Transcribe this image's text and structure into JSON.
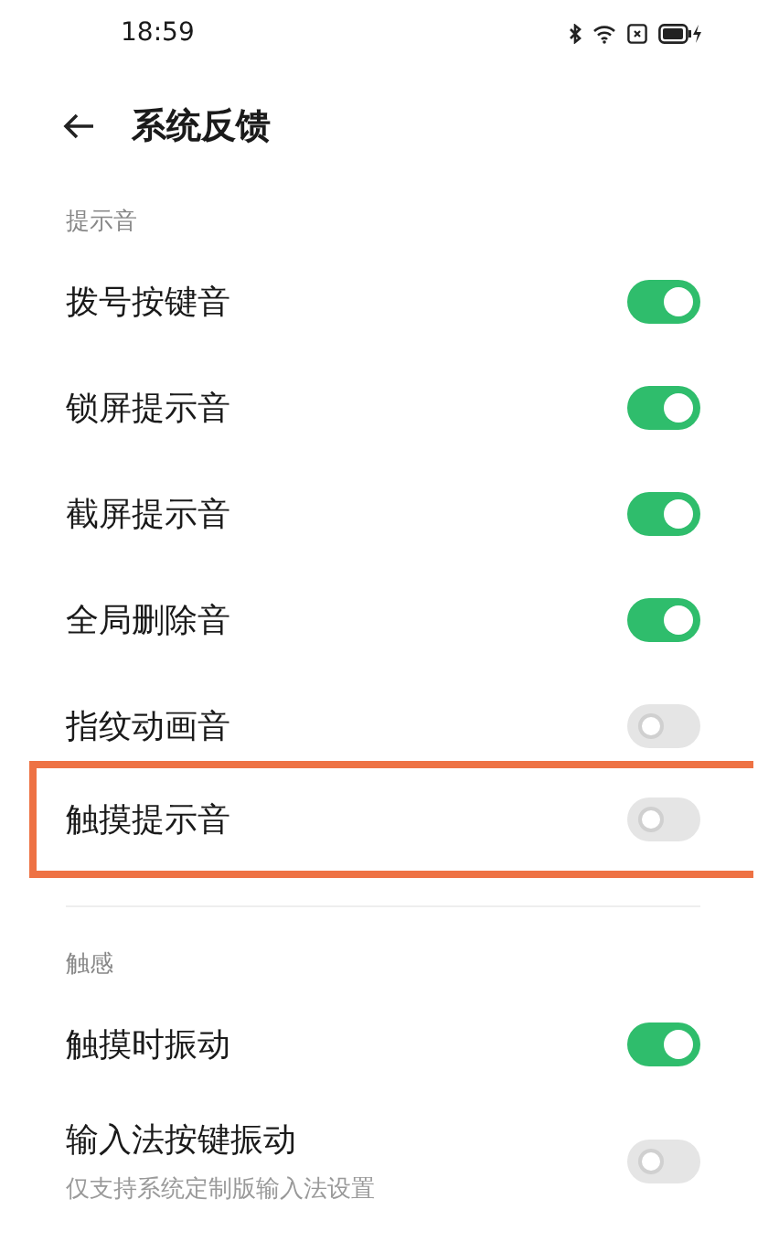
{
  "status_bar": {
    "time": "18:59"
  },
  "header": {
    "title": "系统反馈"
  },
  "sections": [
    {
      "title": "提示音",
      "items": [
        {
          "label": "拨号按键音",
          "on": true,
          "highlighted": false
        },
        {
          "label": "锁屏提示音",
          "on": true,
          "highlighted": false
        },
        {
          "label": "截屏提示音",
          "on": true,
          "highlighted": false
        },
        {
          "label": "全局删除音",
          "on": true,
          "highlighted": false
        },
        {
          "label": "指纹动画音",
          "on": false,
          "highlighted": false
        },
        {
          "label": "触摸提示音",
          "on": false,
          "highlighted": true
        }
      ]
    },
    {
      "title": "触感",
      "items": [
        {
          "label": "触摸时振动",
          "on": true,
          "highlighted": false
        },
        {
          "label": "输入法按键振动",
          "subtitle": "仅支持系统定制版输入法设置",
          "on": false,
          "highlighted": false
        }
      ]
    }
  ]
}
